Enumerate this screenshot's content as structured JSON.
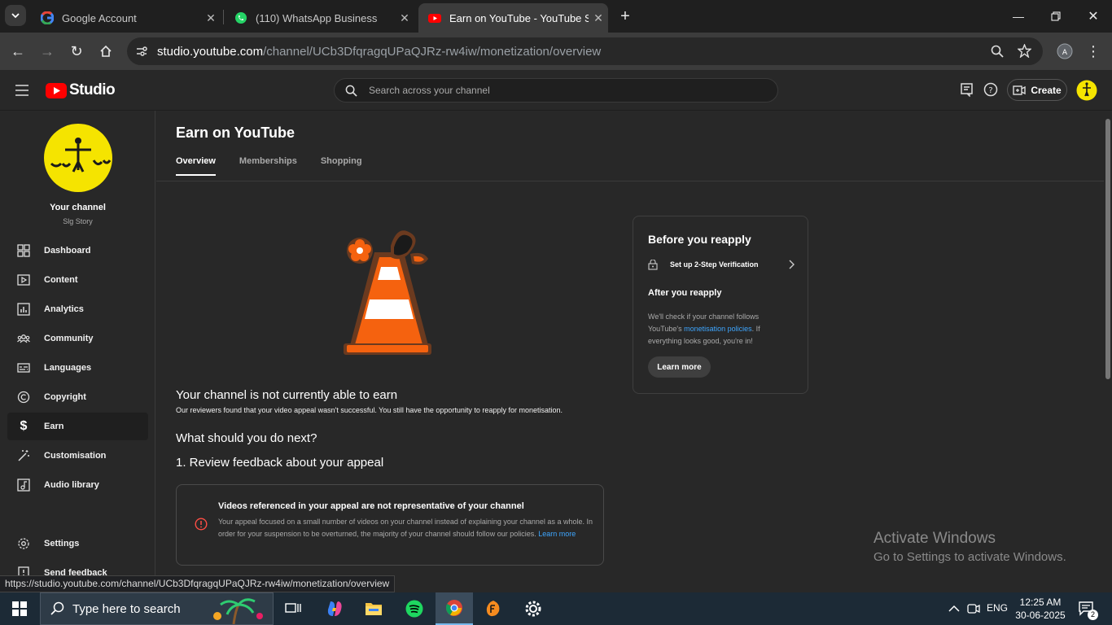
{
  "browser": {
    "tabs": [
      {
        "title": "Google Account",
        "icon": "google-icon"
      },
      {
        "title": "(110) WhatsApp Business",
        "icon": "whatsapp-icon"
      },
      {
        "title": "Earn on YouTube - YouTube Stu",
        "icon": "youtube-icon",
        "active": true
      }
    ],
    "url_host": "studio.youtube.com",
    "url_path": "/channel/UCb3DfqragqUPaQJRz-rw4iw/monetization/overview",
    "status_url": "https://studio.youtube.com/channel/UCb3DfqragqUPaQJRz-rw4iw/monetization/overview"
  },
  "studio": {
    "logo_text": "Studio",
    "search_placeholder": "Search across your channel",
    "create_label": "Create"
  },
  "sidebar": {
    "channel_title": "Your channel",
    "channel_name": "Slg Story",
    "items": [
      {
        "label": "Dashboard",
        "icon": "dashboard-icon"
      },
      {
        "label": "Content",
        "icon": "content-icon"
      },
      {
        "label": "Analytics",
        "icon": "analytics-icon"
      },
      {
        "label": "Community",
        "icon": "community-icon"
      },
      {
        "label": "Languages",
        "icon": "languages-icon"
      },
      {
        "label": "Copyright",
        "icon": "copyright-icon"
      },
      {
        "label": "Earn",
        "icon": "earn-icon",
        "selected": true
      },
      {
        "label": "Customisation",
        "icon": "customisation-icon"
      },
      {
        "label": "Audio library",
        "icon": "audio-library-icon"
      }
    ],
    "settings_label": "Settings",
    "feedback_label": "Send feedback"
  },
  "main": {
    "page_title": "Earn on YouTube",
    "tabs": [
      "Overview",
      "Memberships",
      "Shopping"
    ],
    "status_heading": "Your channel is not currently able to earn",
    "status_body": "Our reviewers found that your video appeal wasn't successful. You still have the opportunity to reapply for monetisation.",
    "next_heading": "What should you do next?",
    "step1_heading": "1. Review feedback about your appeal",
    "feedback_title": "Videos referenced in your appeal are not representative of your channel",
    "feedback_body": "Your appeal focused on a small number of videos on your channel instead of explaining your channel as a whole. In order for your suspension to be overturned, the majority of your channel should follow our policies.",
    "feedback_link": "Learn more"
  },
  "reapply_card": {
    "before_title": "Before you reapply",
    "step_label": "Set up 2-Step Verification",
    "after_title": "After you reapply",
    "after_body_1": "We'll check if your channel follows YouTube's",
    "after_link": "monetisation policies",
    "after_body_2": ". If everything looks good, you're in!",
    "learn_more": "Learn more"
  },
  "watermark": {
    "line1": "Activate Windows",
    "line2": "Go to Settings to activate Windows."
  },
  "taskbar": {
    "search_placeholder": "Type here to search",
    "language": "ENG",
    "time": "12:25 AM",
    "date": "30-06-2025",
    "notification_count": "2"
  },
  "colors": {
    "youtube_red": "#ff0000",
    "link_blue": "#3ea6ff",
    "avatar_yellow": "#f5e400",
    "cone_orange": "#f5620f"
  }
}
